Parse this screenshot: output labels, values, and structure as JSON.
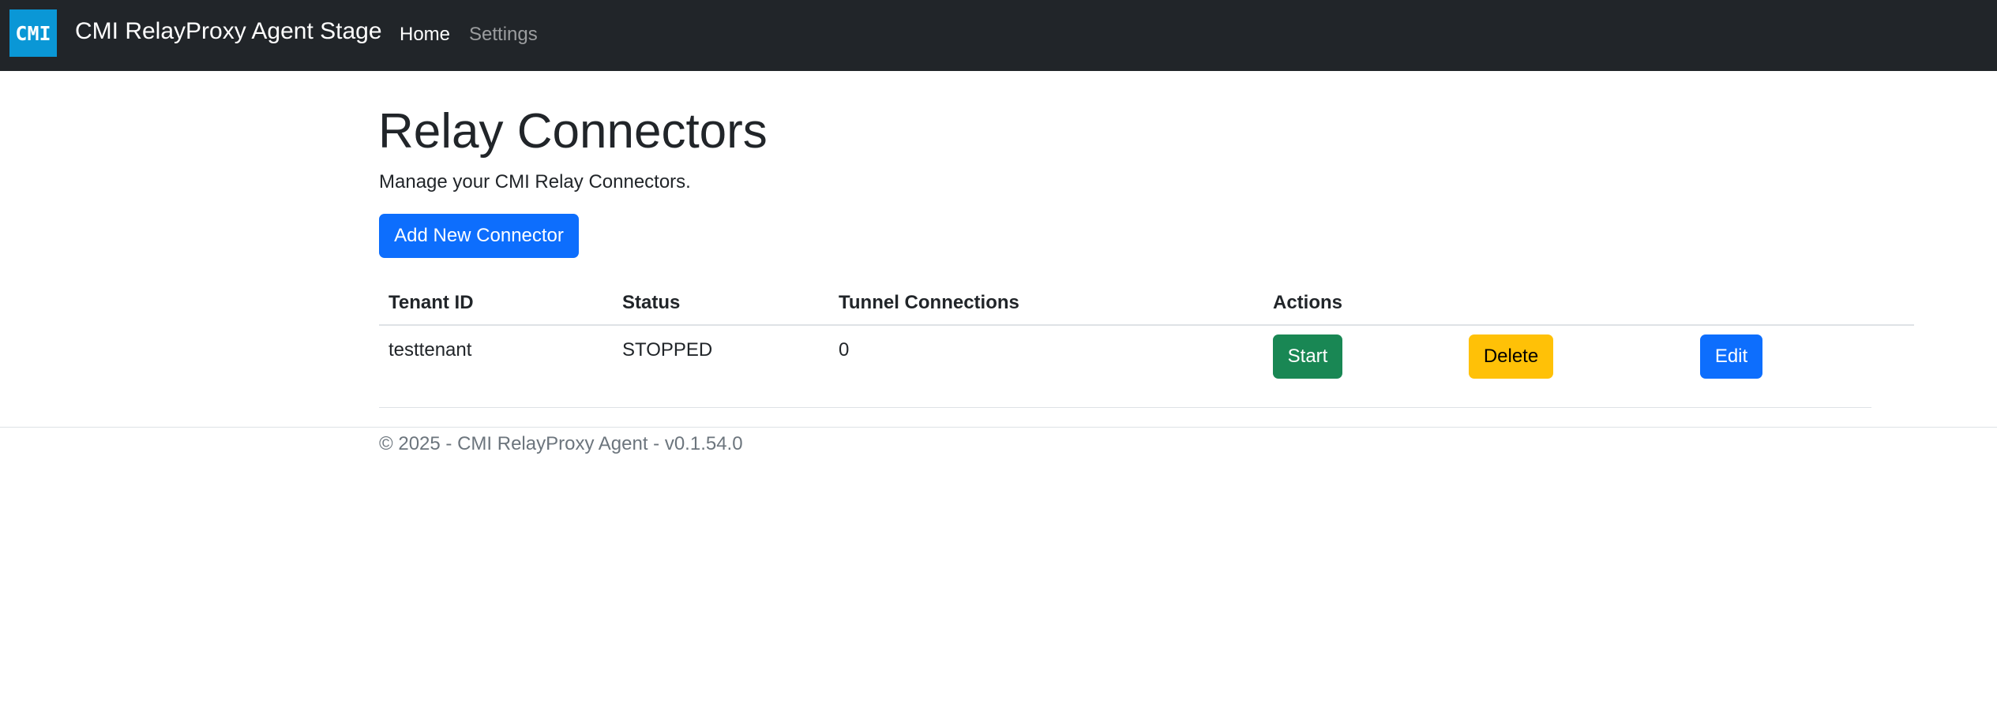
{
  "navbar": {
    "logo_text": "CMI",
    "brand": "CMI RelayProxy Agent Stage",
    "links": [
      {
        "label": "Home",
        "active": true
      },
      {
        "label": "Settings",
        "active": false
      }
    ]
  },
  "main": {
    "title": "Relay Connectors",
    "subtitle": "Manage your CMI Relay Connectors.",
    "add_button_label": "Add New Connector"
  },
  "table": {
    "headers": [
      "Tenant ID",
      "Status",
      "Tunnel Connections",
      "Actions"
    ],
    "rows": [
      {
        "tenant_id": "testtenant",
        "status": "STOPPED",
        "tunnel_connections": "0",
        "actions": {
          "start": "Start",
          "delete": "Delete",
          "edit": "Edit"
        }
      }
    ]
  },
  "footer": {
    "text": "© 2025 - CMI RelayProxy Agent - v0.1.54.0"
  },
  "colors": {
    "navbar_bg": "#212529",
    "logo_bg": "#0a97d6",
    "primary": "#0d6efd",
    "success": "#198754",
    "warning": "#ffc107"
  }
}
